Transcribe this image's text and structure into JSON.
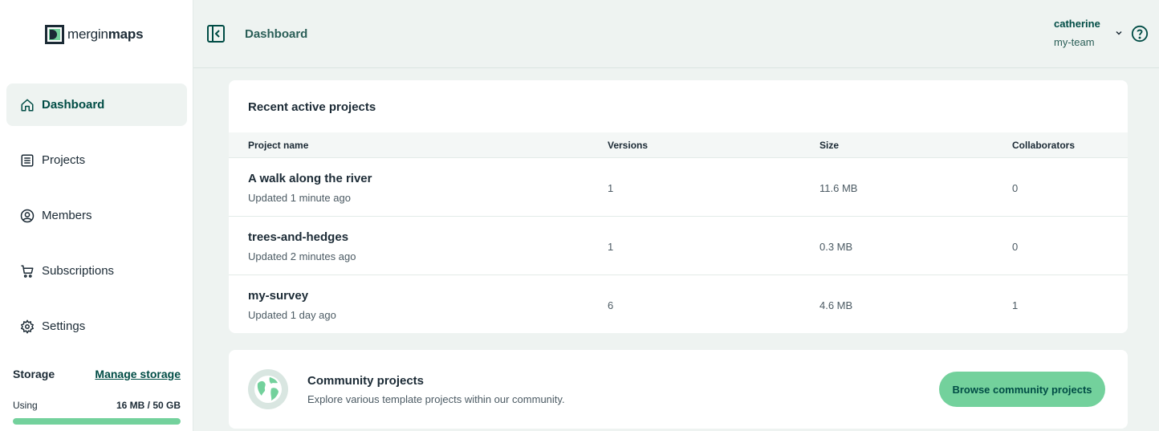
{
  "brand": {
    "name_light": "mergin",
    "name_bold": "maps",
    "accent": "#73d19c",
    "primary": "#004c45"
  },
  "sidebar": {
    "items": [
      {
        "label": "Dashboard",
        "icon": "home-icon",
        "active": true
      },
      {
        "label": "Projects",
        "icon": "list-icon",
        "active": false
      },
      {
        "label": "Members",
        "icon": "user-circle-icon",
        "active": false
      },
      {
        "label": "Subscriptions",
        "icon": "cart-icon",
        "active": false
      },
      {
        "label": "Settings",
        "icon": "gear-icon",
        "active": false
      }
    ],
    "storage": {
      "title": "Storage",
      "manage_label": "Manage storage",
      "using_label": "Using",
      "using_value": "16 MB / 50 GB",
      "used_fraction": 1.0
    }
  },
  "header": {
    "breadcrumb": "Dashboard",
    "user": {
      "name": "catherine",
      "team": "my-team"
    }
  },
  "recent": {
    "title": "Recent active projects",
    "columns": [
      "Project name",
      "Versions",
      "Size",
      "Collaborators"
    ],
    "rows": [
      {
        "name": "A walk along the river",
        "updated": "Updated 1 minute ago",
        "versions": "1",
        "size": "11.6 MB",
        "collaborators": "0"
      },
      {
        "name": "trees-and-hedges",
        "updated": "Updated 2 minutes ago",
        "versions": "1",
        "size": "0.3 MB",
        "collaborators": "0"
      },
      {
        "name": "my-survey",
        "updated": "Updated 1 day ago",
        "versions": "6",
        "size": "4.6 MB",
        "collaborators": "1"
      }
    ]
  },
  "community": {
    "title": "Community projects",
    "description": "Explore various template projects within our community.",
    "button_label": "Browse community projects"
  }
}
